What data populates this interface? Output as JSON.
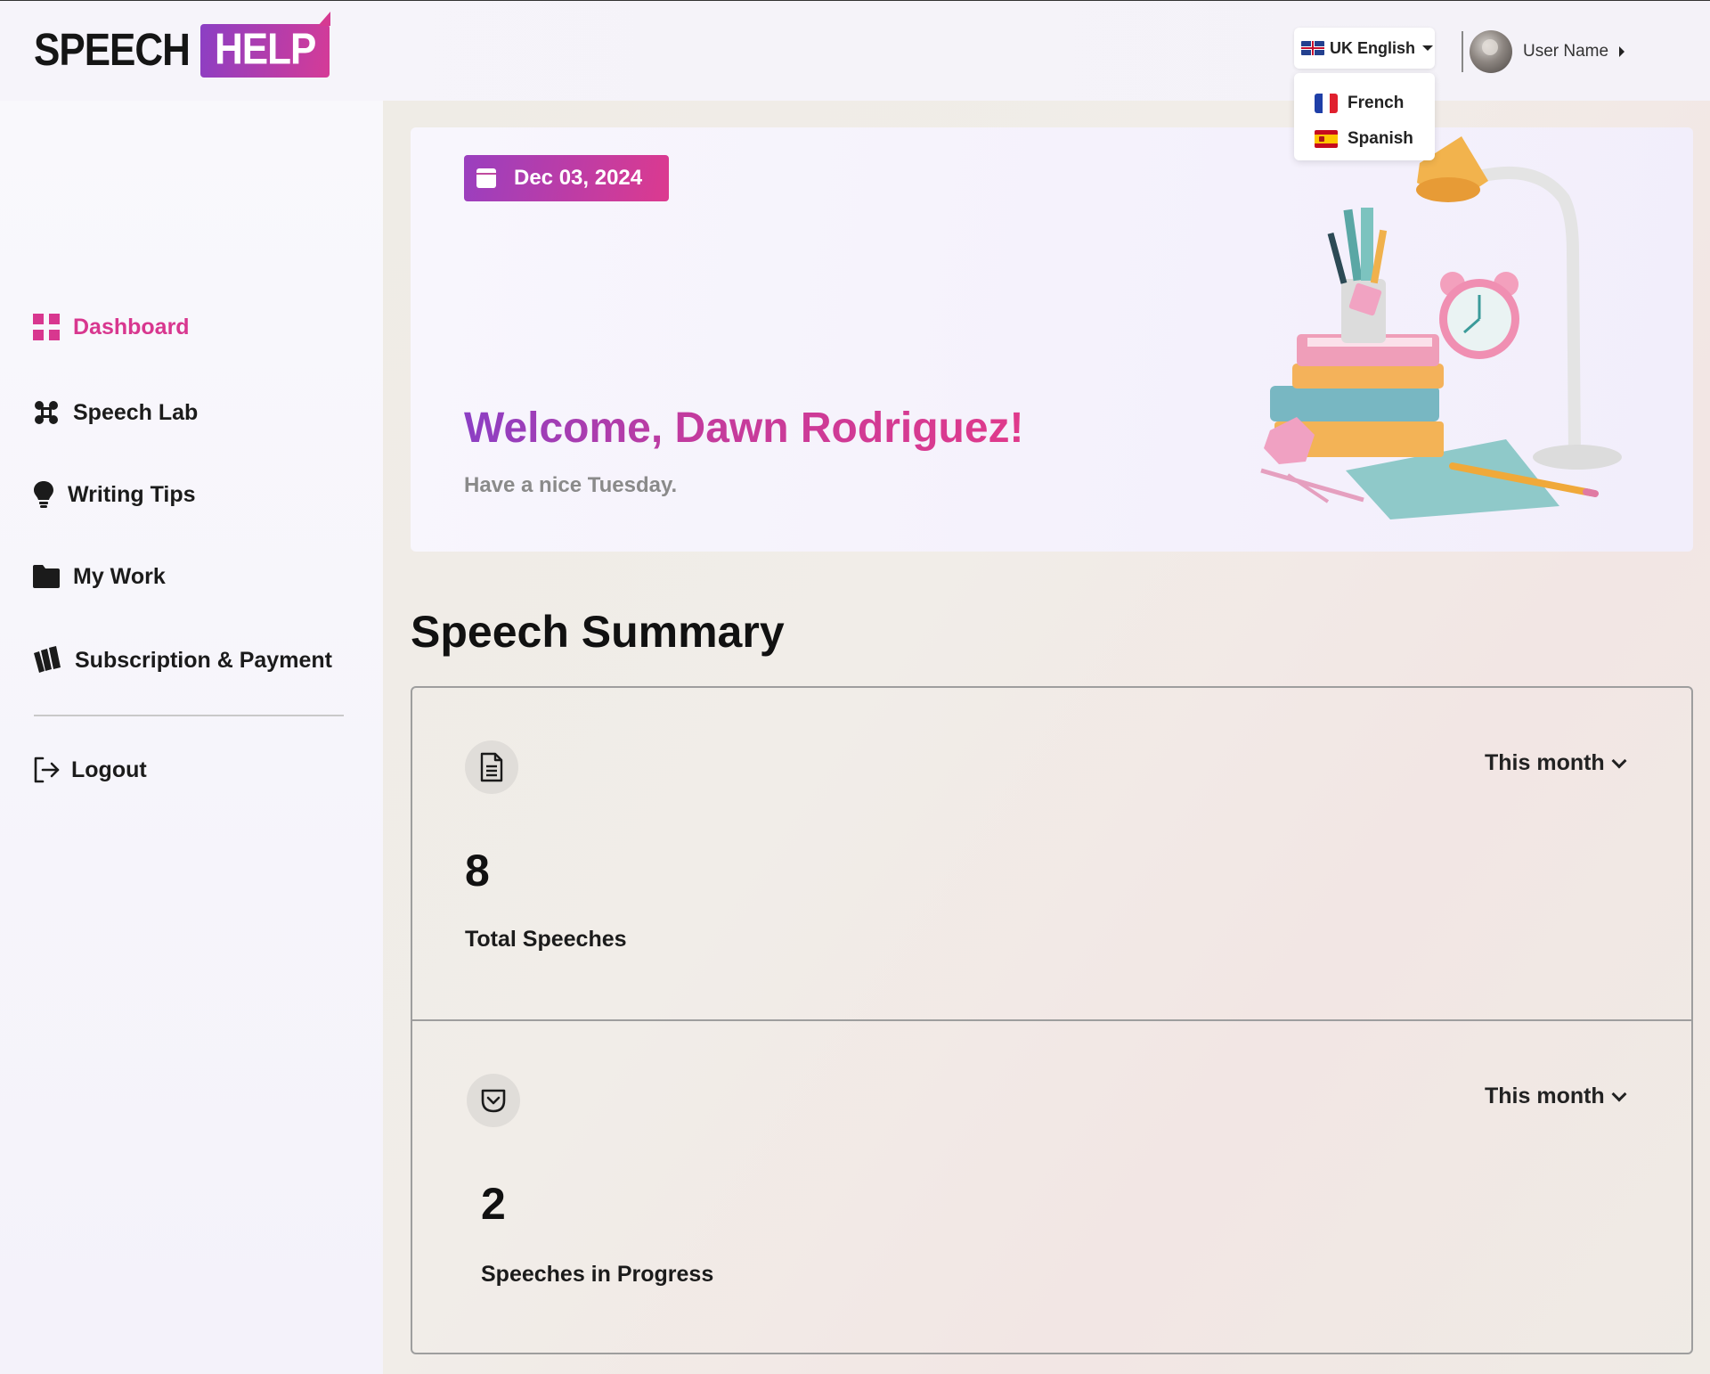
{
  "header": {
    "logo_word1": "SPEECH",
    "logo_word2": "HELP",
    "language": {
      "selected": "UK English",
      "options": [
        "French",
        "Spanish"
      ]
    },
    "user_name": "User Name"
  },
  "sidebar": {
    "items": [
      {
        "label": "Dashboard",
        "icon": "grid-icon",
        "active": true
      },
      {
        "label": "Speech Lab",
        "icon": "command-icon"
      },
      {
        "label": "Writing Tips",
        "icon": "lightbulb-icon"
      },
      {
        "label": "My Work",
        "icon": "folder-icon"
      },
      {
        "label": "Subscription & Payment",
        "icon": "wallet-icon"
      }
    ],
    "logout_label": "Logout"
  },
  "hero": {
    "date": "Dec 03, 2024",
    "welcome": "Welcome, Dawn Rodriguez!",
    "subtitle": "Have a nice Tuesday."
  },
  "summary": {
    "title": "Speech Summary",
    "cards": [
      {
        "value": "8",
        "label": "Total Speeches",
        "period": "This month",
        "icon": "document-icon"
      },
      {
        "value": "2",
        "label": "Speeches in Progress",
        "period": "This month",
        "icon": "pocket-icon"
      }
    ]
  },
  "colors": {
    "accent_pink": "#d8378f",
    "accent_purple": "#8c3fc4"
  }
}
